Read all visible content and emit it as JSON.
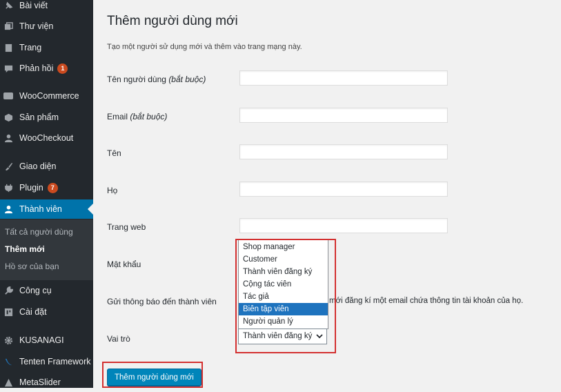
{
  "sidebar": {
    "items": [
      {
        "label": "Bài viết",
        "icon": "pin-icon",
        "badge": null,
        "current": false
      },
      {
        "label": "Thư viện",
        "icon": "media-icon",
        "badge": null,
        "current": false
      },
      {
        "label": "Trang",
        "icon": "page-icon",
        "badge": null,
        "current": false
      },
      {
        "label": "Phản hồi",
        "icon": "comment-icon",
        "badge": "1",
        "current": false
      },
      {
        "label": "WooCommerce",
        "icon": "woo-icon",
        "badge": null,
        "current": false
      },
      {
        "label": "Sản phẩm",
        "icon": "box-icon",
        "badge": null,
        "current": false
      },
      {
        "label": "WooCheckout",
        "icon": "user-icon",
        "badge": null,
        "current": false
      },
      {
        "label": "Giao diện",
        "icon": "brush-icon",
        "badge": null,
        "current": false
      },
      {
        "label": "Plugin",
        "icon": "plug-icon",
        "badge": "7",
        "current": false
      },
      {
        "label": "Thành viên",
        "icon": "users-icon",
        "badge": null,
        "current": true
      },
      {
        "label": "Công cụ",
        "icon": "wrench-icon",
        "badge": null,
        "current": false
      },
      {
        "label": "Cài đặt",
        "icon": "settings-icon",
        "badge": null,
        "current": false
      },
      {
        "label": "KUSANAGI",
        "icon": "gear-icon",
        "badge": null,
        "current": false
      },
      {
        "label": "Tenten Framework",
        "icon": "tenten-icon",
        "badge": null,
        "current": false
      },
      {
        "label": "MetaSlider",
        "icon": "slider-icon",
        "badge": null,
        "current": false
      }
    ],
    "submenu": [
      {
        "label": "Tất cả người dùng",
        "active": false
      },
      {
        "label": "Thêm mới",
        "active": true
      },
      {
        "label": "Hồ sơ của bạn",
        "active": false
      }
    ]
  },
  "main": {
    "title": "Thêm người dùng mới",
    "description": "Tạo một người sử dụng mới và thêm vào trang mạng này.",
    "fields": {
      "username": {
        "label": "Tên người dùng",
        "note": "(bắt buộc)",
        "value": ""
      },
      "email": {
        "label": "Email",
        "note": "(bắt buộc)",
        "value": ""
      },
      "first_name": {
        "label": "Tên",
        "value": ""
      },
      "last_name": {
        "label": "Họ",
        "value": ""
      },
      "website": {
        "label": "Trang web",
        "value": ""
      },
      "password": {
        "label": "Mật khẩu"
      },
      "notify": {
        "label": "Gửi thông báo đến thành viên",
        "text": "mới đăng kí một email chứa thông tin tài khoản của họ."
      },
      "role": {
        "label": "Vai trò",
        "selected": "Thành viên đăng ký",
        "options": [
          "Shop manager",
          "Customer",
          "Thành viên đăng ký",
          "Cộng tác viên",
          "Tác giả",
          "Biên tập viên",
          "Người quản lý"
        ],
        "highlighted": "Biên tập viên"
      }
    },
    "submit_label": "Thêm người dùng mới"
  },
  "colors": {
    "sidebar_bg": "#23282d",
    "sidebar_current": "#0073aa",
    "badge": "#ca4a1f",
    "primary_button": "#0085ba",
    "highlight_box": "#d32f2f",
    "option_highlight": "#1e73be"
  }
}
